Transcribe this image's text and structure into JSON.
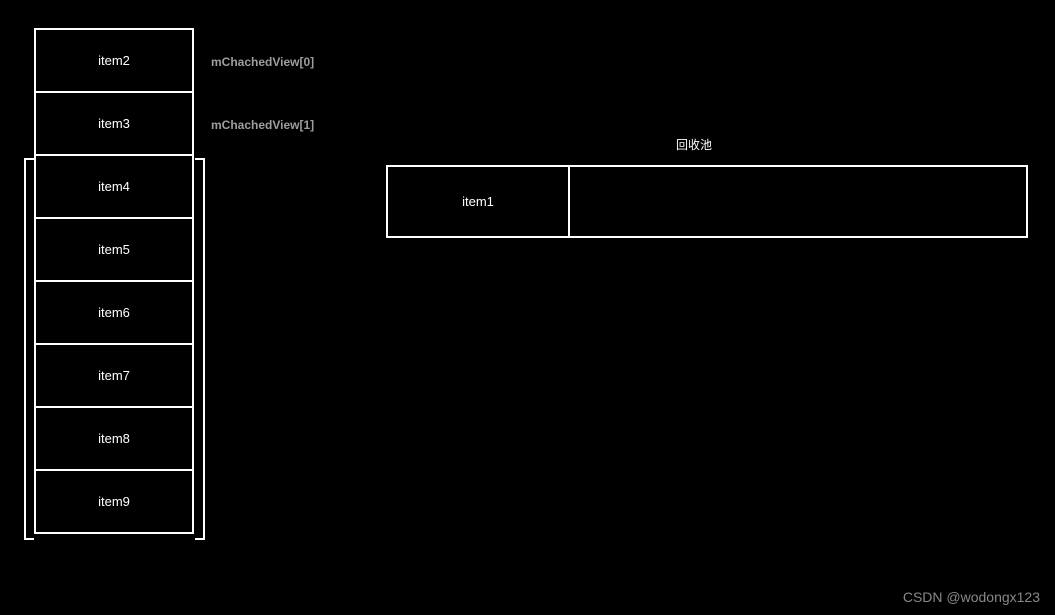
{
  "leftItems": {
    "item0": "item2",
    "item1": "item3",
    "item2": "item4",
    "item3": "item5",
    "item4": "item6",
    "item5": "item7",
    "item6": "item8",
    "item7": "item9"
  },
  "cacheLabels": {
    "label0": "mChachedView[0]",
    "label1": "mChachedView[1]"
  },
  "pool": {
    "title": "回收池",
    "item0": "item1"
  },
  "watermark": "CSDN @wodongx123"
}
